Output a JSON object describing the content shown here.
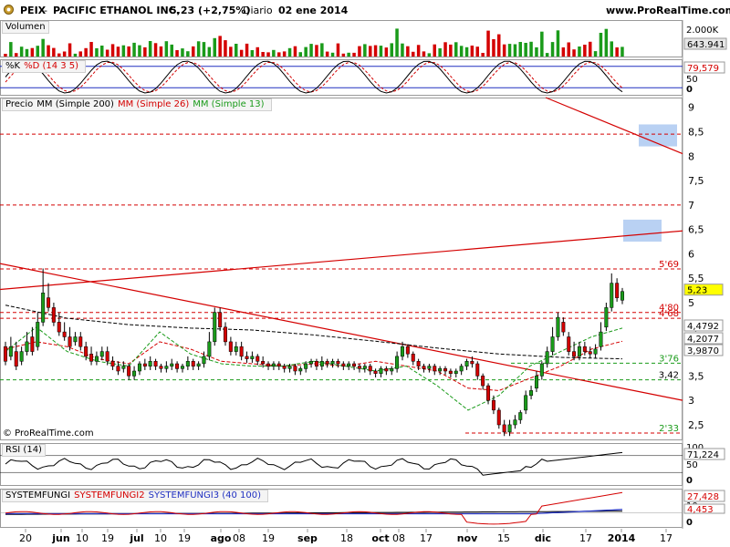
{
  "header": {
    "symbol": "PEIX",
    "name": "PACIFIC ETHANOL INC.",
    "price_change": "5,23 (+2,75%)",
    "period": "Diario",
    "date": "02 ene 2014",
    "site": "www.ProRealTime.com"
  },
  "copyright": "© ProRealTime.com",
  "colors": {
    "up": "#1a9b1a",
    "down": "#d40000",
    "ma200": "#000000",
    "ma26": "#d40000",
    "ma13": "#1a9b1a",
    "rsi": "#000000",
    "rsi_mark": "#2030c0",
    "zone": "#a8c6f0",
    "hline": "#d40000",
    "support": "#1a9b1a"
  },
  "panels": {
    "volume": {
      "title": "Volumen",
      "axis": [
        "2.000K",
        "643.941"
      ]
    },
    "stoch": {
      "title_k": "%K",
      "title_d": "%D (14 3 5)",
      "axis": [
        "100",
        "79,579",
        "50",
        "0"
      ]
    },
    "price": {
      "title": "Precio",
      "ma200": "MM (Simple 200)",
      "ma26": "MM (Simple 26)",
      "ma13": "MM (Simple 13)",
      "axis": [
        "9",
        "8,5",
        "8",
        "7,5",
        "7",
        "6,5",
        "6",
        "5,5",
        "5",
        "4,5",
        "3,5",
        "3",
        "2,5"
      ],
      "badges": [
        "5,23",
        "4,4792",
        "4,2077",
        "3,9870"
      ],
      "levels": [
        "5'69",
        "4'80",
        "4'68",
        "3'76",
        "3,42",
        "2'33"
      ]
    },
    "rsi": {
      "title": "RSI (14)",
      "axis": [
        "100",
        "71,224",
        "50",
        "0"
      ]
    },
    "sysf": {
      "t1": "SYSTEMFUNGI",
      "t2": "SYSTEMFUNGI2",
      "t3": "SYSTEMFUNGI3 (40 100)",
      "axis": [
        "27,428",
        "10",
        "4,453",
        "0"
      ]
    }
  },
  "x_axis": [
    "20",
    "jun",
    "10",
    "19",
    "jul",
    "10",
    "19",
    "ago",
    "08",
    "19",
    "sep",
    "18",
    "oct",
    "08",
    "17",
    "nov",
    "15",
    "dic",
    "17",
    "2014",
    "17"
  ],
  "chart_data": {
    "type": "candlestick",
    "series": [
      {
        "name": "PEIX",
        "values": [
          [
            4.1,
            3.8,
            4.2
          ],
          [
            3.9,
            4.1,
            4.3
          ],
          [
            4.0,
            3.7,
            4.2
          ],
          [
            3.8,
            4.0,
            4.1
          ],
          [
            4.0,
            4.2,
            4.4
          ],
          [
            4.3,
            4.0,
            4.5
          ],
          [
            4.1,
            4.6,
            4.8
          ],
          [
            4.6,
            5.2,
            5.7
          ],
          [
            5.1,
            4.9,
            5.4
          ],
          [
            4.9,
            4.6,
            5.0
          ],
          [
            4.6,
            4.4,
            4.8
          ],
          [
            4.4,
            4.3,
            4.6
          ],
          [
            4.3,
            4.1,
            4.5
          ],
          [
            4.2,
            4.3,
            4.4
          ],
          [
            4.3,
            4.1,
            4.4
          ],
          [
            4.1,
            3.9,
            4.2
          ],
          [
            3.95,
            3.8,
            4.1
          ],
          [
            3.8,
            3.9,
            4.0
          ],
          [
            3.9,
            4.0,
            4.1
          ],
          [
            4.0,
            3.8,
            4.1
          ],
          [
            3.8,
            3.7,
            3.9
          ],
          [
            3.7,
            3.6,
            3.8
          ],
          [
            3.65,
            3.7,
            3.8
          ],
          [
            3.7,
            3.5,
            3.75
          ],
          [
            3.5,
            3.6,
            3.7
          ],
          [
            3.6,
            3.75,
            3.8
          ],
          [
            3.75,
            3.7,
            3.85
          ],
          [
            3.7,
            3.8,
            3.9
          ],
          [
            3.8,
            3.7,
            3.85
          ],
          [
            3.7,
            3.65,
            3.75
          ],
          [
            3.65,
            3.7,
            3.8
          ],
          [
            3.7,
            3.75,
            3.85
          ],
          [
            3.75,
            3.65,
            3.8
          ],
          [
            3.65,
            3.7,
            3.75
          ],
          [
            3.7,
            3.8,
            3.9
          ],
          [
            3.8,
            3.7,
            3.85
          ],
          [
            3.7,
            3.75,
            3.8
          ],
          [
            3.75,
            3.9,
            4.0
          ],
          [
            3.9,
            4.2,
            4.4
          ],
          [
            4.2,
            4.8,
            4.9
          ],
          [
            4.8,
            4.5,
            4.9
          ],
          [
            4.5,
            4.2,
            4.6
          ],
          [
            4.2,
            4.0,
            4.3
          ],
          [
            4.0,
            4.1,
            4.2
          ],
          [
            4.1,
            3.9,
            4.2
          ],
          [
            3.9,
            3.85,
            4.0
          ],
          [
            3.85,
            3.9,
            4.0
          ],
          [
            3.9,
            3.8,
            3.95
          ],
          [
            3.8,
            3.75,
            3.9
          ],
          [
            3.75,
            3.7,
            3.8
          ],
          [
            3.7,
            3.75,
            3.8
          ],
          [
            3.75,
            3.7,
            3.8
          ],
          [
            3.7,
            3.65,
            3.75
          ],
          [
            3.65,
            3.7,
            3.75
          ],
          [
            3.7,
            3.6,
            3.75
          ],
          [
            3.6,
            3.65,
            3.7
          ],
          [
            3.65,
            3.75,
            3.8
          ],
          [
            3.75,
            3.8,
            3.85
          ],
          [
            3.8,
            3.7,
            3.85
          ],
          [
            3.7,
            3.8,
            3.9
          ],
          [
            3.8,
            3.75,
            3.85
          ],
          [
            3.75,
            3.8,
            3.85
          ],
          [
            3.8,
            3.75,
            3.85
          ],
          [
            3.75,
            3.7,
            3.8
          ],
          [
            3.7,
            3.75,
            3.8
          ],
          [
            3.75,
            3.7,
            3.8
          ],
          [
            3.7,
            3.65,
            3.75
          ],
          [
            3.65,
            3.7,
            3.75
          ],
          [
            3.7,
            3.6,
            3.75
          ],
          [
            3.6,
            3.55,
            3.65
          ],
          [
            3.55,
            3.65,
            3.7
          ],
          [
            3.65,
            3.6,
            3.7
          ],
          [
            3.6,
            3.65,
            3.7
          ],
          [
            3.65,
            3.9,
            4.0
          ],
          [
            3.9,
            4.1,
            4.2
          ],
          [
            4.1,
            3.95,
            4.15
          ],
          [
            3.95,
            3.8,
            4.0
          ],
          [
            3.8,
            3.7,
            3.85
          ],
          [
            3.7,
            3.65,
            3.75
          ],
          [
            3.65,
            3.7,
            3.75
          ],
          [
            3.7,
            3.6,
            3.75
          ],
          [
            3.6,
            3.65,
            3.7
          ],
          [
            3.65,
            3.6,
            3.7
          ],
          [
            3.6,
            3.55,
            3.65
          ],
          [
            3.55,
            3.6,
            3.65
          ],
          [
            3.6,
            3.7,
            3.75
          ],
          [
            3.7,
            3.8,
            3.85
          ],
          [
            3.8,
            3.75,
            3.9
          ],
          [
            3.75,
            3.5,
            3.8
          ],
          [
            3.5,
            3.3,
            3.55
          ],
          [
            3.3,
            3.0,
            3.35
          ],
          [
            3.0,
            2.8,
            3.1
          ],
          [
            2.8,
            2.5,
            2.85
          ],
          [
            2.5,
            2.35,
            2.6
          ],
          [
            2.35,
            2.5,
            2.6
          ],
          [
            2.5,
            2.6,
            2.7
          ],
          [
            2.6,
            2.75,
            2.8
          ],
          [
            2.8,
            3.1,
            3.2
          ],
          [
            3.1,
            3.2,
            3.3
          ],
          [
            3.25,
            3.5,
            3.6
          ],
          [
            3.5,
            3.75,
            3.8
          ],
          [
            3.75,
            4.0,
            4.1
          ],
          [
            4.0,
            4.3,
            4.5
          ],
          [
            4.3,
            4.7,
            4.8
          ],
          [
            4.6,
            4.4,
            4.7
          ],
          [
            4.3,
            4.0,
            4.4
          ],
          [
            4.0,
            3.9,
            4.2
          ],
          [
            3.9,
            4.1,
            4.2
          ],
          [
            4.1,
            4.0,
            4.2
          ],
          [
            4.0,
            3.95,
            4.1
          ],
          [
            3.95,
            4.05,
            4.15
          ],
          [
            4.1,
            4.4,
            4.6
          ],
          [
            4.5,
            4.9,
            5.0
          ],
          [
            4.9,
            5.4,
            5.6
          ],
          [
            5.4,
            5.1,
            5.5
          ],
          [
            5.05,
            5.23,
            5.3
          ]
        ]
      },
      {
        "name": "MM (Simple 200)",
        "values": [
          4.95,
          4.68,
          4.55,
          4.48,
          4.44,
          4.34,
          4.21,
          4.07,
          3.95,
          3.88,
          3.85
        ]
      },
      {
        "name": "MM (Simple 26)",
        "values": [
          4.05,
          4.2,
          4.1,
          3.85,
          3.75,
          4.2,
          4.05,
          3.8,
          3.75,
          3.7,
          3.75,
          3.7,
          3.8,
          3.7,
          3.6,
          3.25,
          3.2,
          3.45,
          3.7,
          4.05,
          4.21
        ]
      },
      {
        "name": "MM (Simple 13)",
        "values": [
          4.0,
          4.5,
          4.0,
          3.8,
          3.7,
          4.4,
          3.95,
          3.75,
          3.7,
          3.7,
          3.8,
          3.7,
          3.6,
          3.7,
          3.3,
          2.8,
          3.1,
          3.7,
          4.0,
          4.3,
          4.48
        ]
      }
    ],
    "ylim": [
      2.2,
      9.2
    ]
  }
}
